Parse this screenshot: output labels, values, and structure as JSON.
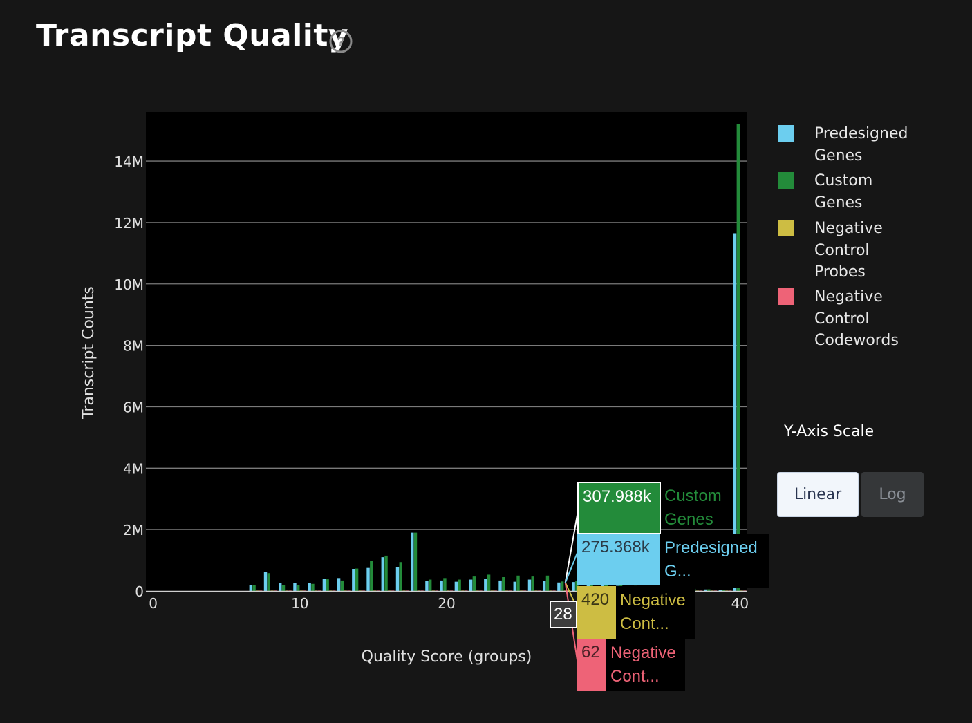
{
  "page": {
    "title": "Transcript Quality",
    "help_icon": "question-circle-icon"
  },
  "chart_data": {
    "type": "bar",
    "title": "",
    "xlabel": "Quality Score (groups)",
    "ylabel": "Transcript Counts",
    "xlim": [
      -0.5,
      40.5
    ],
    "ylim": [
      0,
      15600000
    ],
    "x_ticks": [
      0,
      10,
      20,
      40
    ],
    "x_tick_labels": [
      "0",
      "10",
      "20",
      "40"
    ],
    "y_ticks": [
      0,
      2000000,
      4000000,
      6000000,
      8000000,
      10000000,
      12000000,
      14000000
    ],
    "y_tick_labels": [
      "0",
      "2M",
      "4M",
      "6M",
      "8M",
      "10M",
      "12M",
      "14M"
    ],
    "grid": true,
    "legend_position": "right",
    "x": [
      7,
      8,
      9,
      10,
      11,
      12,
      13,
      14,
      15,
      16,
      17,
      18,
      19,
      20,
      21,
      22,
      23,
      24,
      25,
      26,
      27,
      28,
      29,
      30,
      31,
      32,
      33,
      34,
      35,
      36,
      37,
      38,
      39,
      40
    ],
    "series": [
      {
        "name": "Predesigned Genes",
        "color": "#6cceef",
        "values": [
          200000,
          630000,
          260000,
          260000,
          260000,
          400000,
          420000,
          720000,
          750000,
          1100000,
          780000,
          1900000,
          330000,
          340000,
          300000,
          370000,
          400000,
          340000,
          300000,
          370000,
          330000,
          275368,
          290000,
          230000,
          200000,
          170000,
          150000,
          120000,
          100000,
          80000,
          60000,
          50000,
          40000,
          11650000
        ]
      },
      {
        "name": "Custom Genes",
        "color": "#238b3a",
        "values": [
          180000,
          580000,
          190000,
          180000,
          230000,
          380000,
          340000,
          730000,
          980000,
          1150000,
          940000,
          1900000,
          370000,
          420000,
          370000,
          470000,
          530000,
          450000,
          500000,
          470000,
          500000,
          307988,
          320000,
          260000,
          220000,
          190000,
          160000,
          130000,
          110000,
          90000,
          70000,
          55000,
          45000,
          15200000
        ]
      },
      {
        "name": "Negative Control Probes",
        "color": "#cdbd43",
        "values": [
          3000,
          5000,
          4000,
          4000,
          3000,
          3000,
          3000,
          4000,
          4000,
          4000,
          3000,
          3000,
          2000,
          2000,
          1500,
          1500,
          1200,
          1000,
          900,
          800,
          600,
          420,
          400,
          350,
          300,
          250,
          200,
          180,
          150,
          120,
          100,
          80,
          60,
          2000
        ]
      },
      {
        "name": "Negative Control Codewords",
        "color": "#ee6377",
        "values": [
          800,
          1500,
          1200,
          1000,
          900,
          900,
          800,
          800,
          700,
          700,
          600,
          600,
          400,
          400,
          300,
          300,
          250,
          200,
          150,
          120,
          90,
          62,
          60,
          50,
          40,
          35,
          30,
          25,
          20,
          15,
          12,
          10,
          8,
          500
        ]
      }
    ],
    "hover": {
      "x_label": "28",
      "items": [
        {
          "value": "307.988k",
          "name": "Custom Genes",
          "color": "#238b3a"
        },
        {
          "value": "275.368k",
          "name": "Predesigned G...",
          "color": "#6cceef"
        },
        {
          "value": "420",
          "name": "Negative Cont...",
          "color": "#cdbd43"
        },
        {
          "value": "62",
          "name": "Negative Cont...",
          "color": "#ee6377"
        }
      ]
    }
  },
  "legend": {
    "items": [
      {
        "label": "Predesigned Genes",
        "color": "#6cceef"
      },
      {
        "label": "Custom Genes",
        "color": "#238b3a"
      },
      {
        "label": "Negative Control Probes",
        "color": "#cdbd43"
      },
      {
        "label": "Negative Control Codewords",
        "color": "#ee6377"
      }
    ]
  },
  "y_scale": {
    "label": "Y-Axis Scale",
    "options": [
      "Linear",
      "Log"
    ],
    "selected": "Linear"
  }
}
